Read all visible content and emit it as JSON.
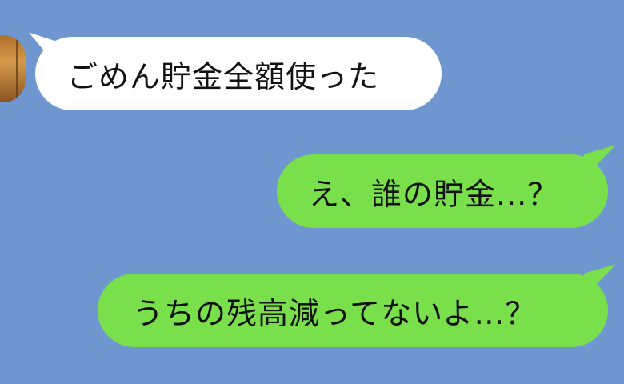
{
  "colors": {
    "background": "#7096cf",
    "incoming_bubble": "#ffffff",
    "outgoing_bubble": "#79e04c",
    "text": "#111111"
  },
  "messages": [
    {
      "direction": "incoming",
      "text": "ごめん貯金全額使った"
    },
    {
      "direction": "outgoing",
      "text": "え、誰の貯金...？"
    },
    {
      "direction": "outgoing",
      "text": "うちの残高減ってないよ…？"
    }
  ],
  "icons": {
    "avatar": "contact-avatar"
  }
}
